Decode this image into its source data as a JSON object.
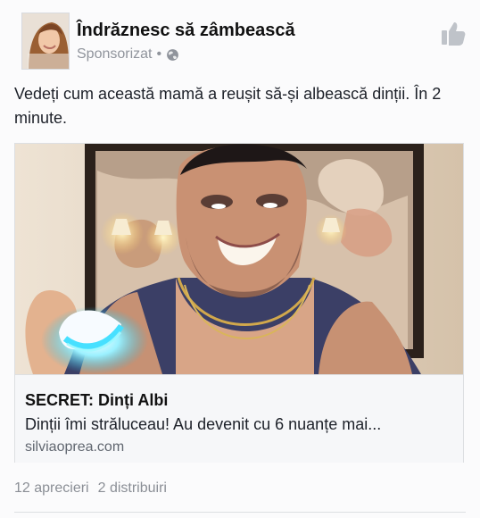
{
  "post": {
    "page_name": "Îndrăznesc să zâmbească",
    "meta_label": "Sponsorizat",
    "meta_separator": "•",
    "privacy_icon": "globe-icon",
    "like_icon": "thumbs-up-icon",
    "text": "Vedeți cum această mamă a reușit să-și albească dinții. În 2 minute.",
    "card": {
      "title": "SECRET: Dinți Albi",
      "description": "Dinții îmi străluceau! Au devenit cu 6 nuanțe mai...",
      "domain": "silviaoprea.com"
    },
    "stats": {
      "likes": "12 aprecieri",
      "shares": "2 distribuiri"
    }
  }
}
